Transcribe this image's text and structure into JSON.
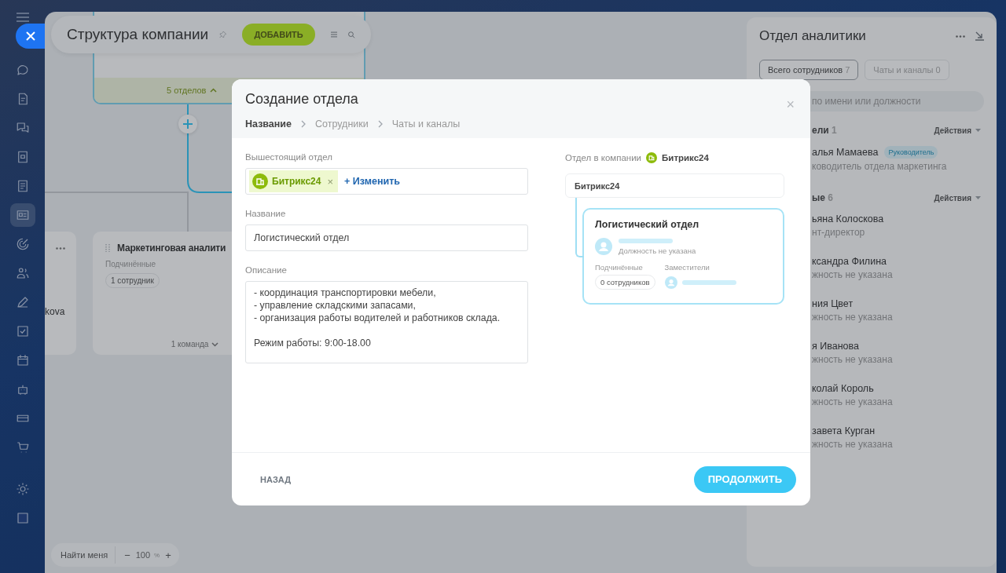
{
  "sidebar": {
    "items": [
      {
        "selected": false
      },
      {
        "selected": false
      },
      {
        "selected": false
      },
      {
        "selected": false
      },
      {
        "selected": false
      },
      {
        "selected": true
      },
      {
        "selected": false
      },
      {
        "selected": false
      },
      {
        "selected": false
      },
      {
        "selected": false
      },
      {
        "selected": false
      },
      {
        "selected": false
      },
      {
        "selected": false
      },
      {
        "selected": false
      },
      {
        "selected": false
      },
      {
        "selected": false
      }
    ]
  },
  "canvas": {
    "title": "Структура компании",
    "add_button": "ДОБАВИТЬ",
    "top_node": {
      "footer": "5 отделов"
    },
    "left_node": {
      "text": "kova"
    },
    "node": {
      "title": "Маркетинговая аналити",
      "subordinates_label": "Подчинённые",
      "subordinates": "1 сотрудник",
      "footer": "1 команда"
    },
    "find_me": "Найти меня",
    "zoom_out": "−",
    "zoom": "100",
    "zoom_unit": "%",
    "zoom_in": "+"
  },
  "panel": {
    "title": "Отдел аналитики",
    "tabs": [
      {
        "label": "Всего сотрудников",
        "count": "7",
        "selected": true
      },
      {
        "label": "Чаты и каналы",
        "count": "0",
        "selected": false
      }
    ],
    "search": {
      "placeholder": "по имени или должности"
    },
    "sections": [
      {
        "title": "ели",
        "count": "1",
        "action": "Действия",
        "people": [
          {
            "name": "алья Мамаева",
            "badge": "Руководитель",
            "position": "ководитель отдела маркетинга"
          }
        ]
      },
      {
        "title": "ые",
        "count": "6",
        "action": "Действия",
        "people": [
          {
            "name": "ьяна Колоскова",
            "position": "нт-директор"
          },
          {
            "name": "ксандра Филина",
            "position": "жность не указана"
          },
          {
            "name": "ния Цвет",
            "position": "жность не указана"
          },
          {
            "name": "я Иванова",
            "position": "жность не указана"
          },
          {
            "name": "колай Король",
            "position": "жность не указана"
          },
          {
            "name": "завета Курган",
            "position": "жность не указана"
          }
        ]
      }
    ]
  },
  "modal": {
    "title": "Создание отдела",
    "close": "×",
    "steps": [
      {
        "label": "Название",
        "selected": true
      },
      {
        "label": "Сотрудники",
        "selected": false
      },
      {
        "label": "Чаты и каналы",
        "selected": false
      }
    ],
    "parent": {
      "label": "Вышестоящий отдел",
      "chip": "Битрикс24",
      "chip_remove": "×",
      "change": "+ Изменить"
    },
    "name": {
      "label": "Название",
      "value": "Логистический отдел"
    },
    "description": {
      "label": "Описание",
      "value": "- координация транспортировки мебели,\n- управление складскими запасами,\n- организация работы водителей и работников склада.\n\nРежим работы: 9:00-18.00"
    },
    "preview": {
      "label": "Отдел в компании",
      "company": "Битрикс24",
      "root": "Битрикс24",
      "node": {
        "title": "Логистический отдел",
        "head_position": "Должность не указана",
        "subordinates_label": "Подчинённые",
        "subordinates": "0 сотрудников",
        "deputies_label": "Заместители"
      }
    },
    "back": "НАЗАД",
    "next": "ПРОДОЛЖИТЬ"
  }
}
